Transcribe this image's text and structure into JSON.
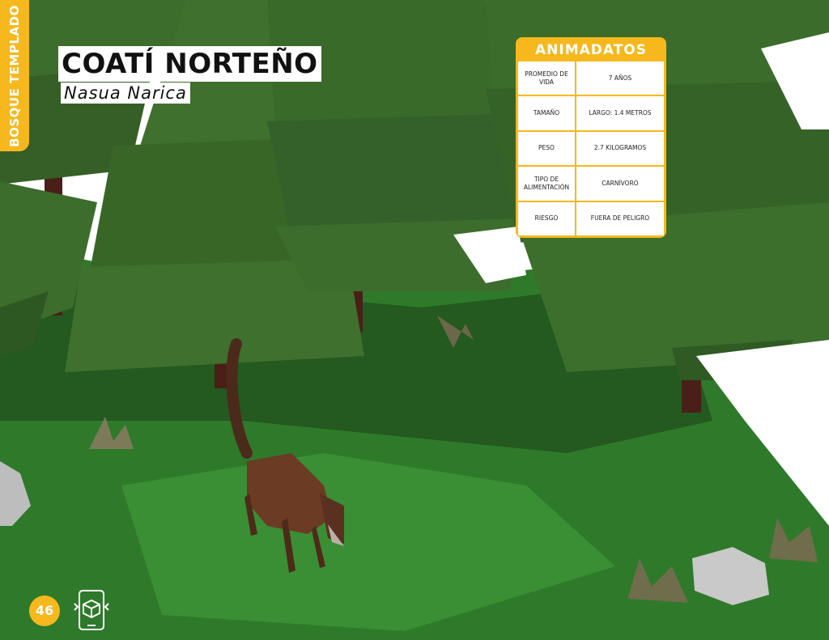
{
  "section_tab": {
    "label": "BOSQUE TEMPLADO"
  },
  "header": {
    "title": "COATÍ NORTEÑO",
    "scientific_name": "Nasua Narica"
  },
  "factsheet": {
    "title": "ANIMADATOS",
    "rows": [
      {
        "label": "PROMEDIO DE VIDA",
        "value": "7 AÑOS"
      },
      {
        "label": "TAMAÑO",
        "value": "LARGO: 1.4 METROS"
      },
      {
        "label": "PESO",
        "value": "2.7 KILOGRAMOS"
      },
      {
        "label": "TIPO DE ALIMENTACIÓN",
        "value": "CARNÍVORO"
      },
      {
        "label": "RIESGO",
        "value": "FUERA DE PELIGRO"
      }
    ]
  },
  "footer": {
    "page_number": "46",
    "ar_icon": "augmented-reality-phone-icon"
  },
  "colors": {
    "accent": "#f6b81c",
    "grass": "#2f7d2b",
    "foliage": "#3b6b2a"
  }
}
